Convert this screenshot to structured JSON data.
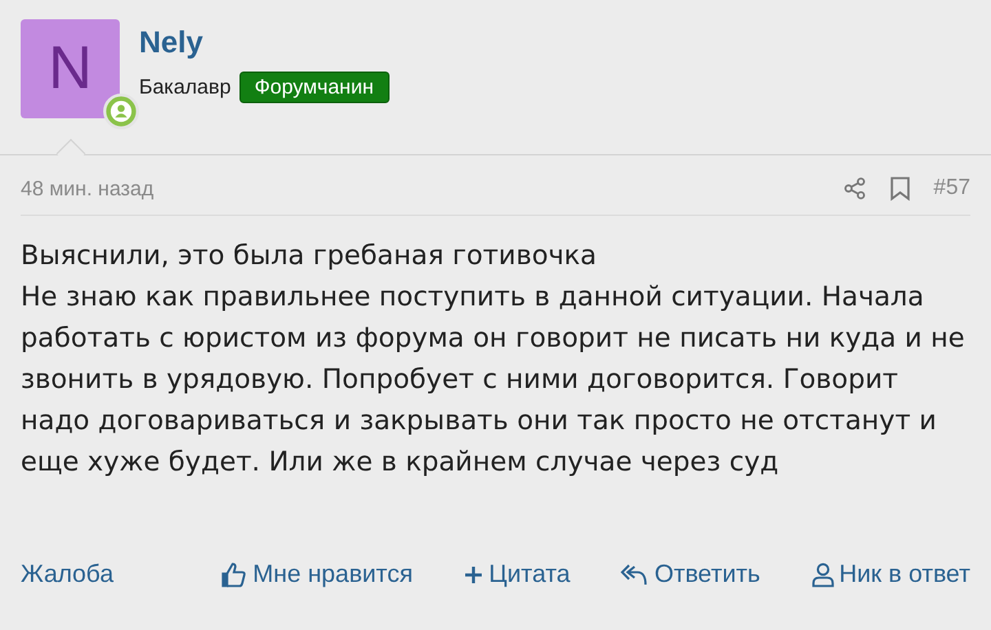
{
  "author": {
    "initial": "N",
    "name": "Nely",
    "title": "Бакалавр",
    "badge": "Форумчанин"
  },
  "post": {
    "time": "48 мин. назад",
    "number": "#57",
    "paragraphs": [
      "Выяснили, это была гребаная готивочка",
      "Не знаю как правильнее поступить в данной ситуации. Начала работать с юристом из форума он говорит не писать ни куда и не звонить в урядовую. Попробует с ними договорится. Говорит надо договариваться и закрывать они так просто не отстанут и еще хуже будет. Или же в крайнем случае через суд"
    ]
  },
  "actions": [
    {
      "kind": "report",
      "label": "Жалоба"
    },
    {
      "kind": "like",
      "label": "Мне нравится"
    },
    {
      "kind": "quote",
      "label": "Цитата"
    },
    {
      "kind": "reply",
      "label": "Ответить"
    },
    {
      "kind": "mention",
      "label": "Ник в ответ"
    }
  ]
}
